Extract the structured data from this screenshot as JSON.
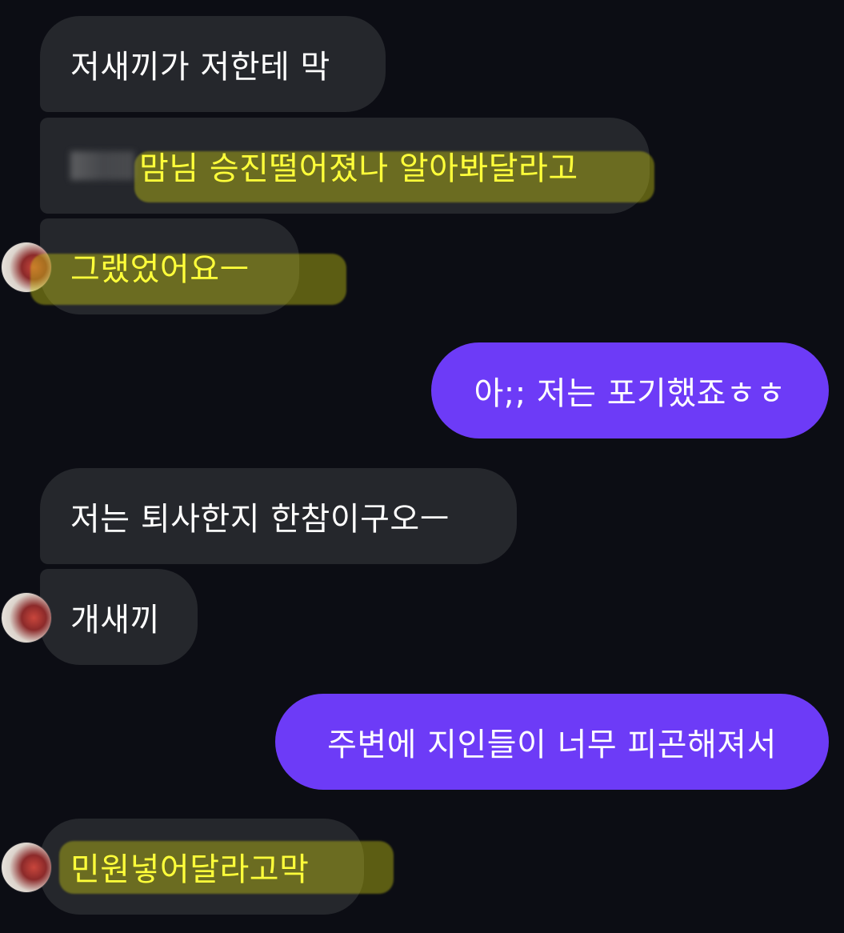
{
  "messages": [
    {
      "id": 1,
      "direction": "incoming",
      "text": "저새끼가 저한테 막",
      "highlighted": false
    },
    {
      "id": 2,
      "direction": "incoming",
      "text": "맘님 승진떨어졌나 알아봐달라고",
      "highlighted": true,
      "redacted_prefix": true
    },
    {
      "id": 3,
      "direction": "incoming",
      "text": "그랬었어요ㅡ",
      "highlighted": true
    },
    {
      "id": 4,
      "direction": "outgoing",
      "text": "아;; 저는 포기했죠ㅎㅎ",
      "highlighted": false
    },
    {
      "id": 5,
      "direction": "incoming",
      "text": "저는 퇴사한지 한참이구오ㅡ",
      "highlighted": false
    },
    {
      "id": 6,
      "direction": "incoming",
      "text": "개새끼",
      "highlighted": false
    },
    {
      "id": 7,
      "direction": "outgoing",
      "text": "주변에 지인들이 너무 피곤해져서",
      "highlighted": false
    },
    {
      "id": 8,
      "direction": "incoming",
      "text": "민원넣어달라고막",
      "highlighted": true
    }
  ],
  "colors": {
    "background": "#0c0d14",
    "incoming_bubble": "#25272c",
    "outgoing_bubble": "#6d3bf7",
    "text": "#ffffff",
    "highlight_text": "#ffff3a",
    "highlight_marker": "#cdcd14"
  }
}
